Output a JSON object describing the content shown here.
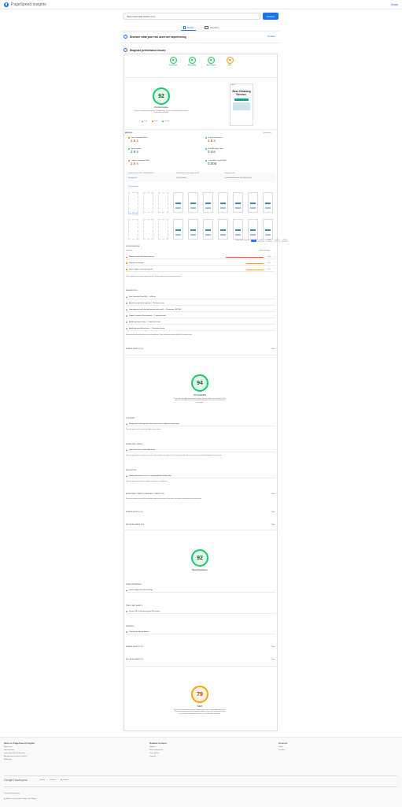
{
  "app": {
    "title": "PageSpeed Insights",
    "share_label": "Share"
  },
  "search": {
    "url": "https://example.teplicn.com",
    "analyze_label": "Analyze"
  },
  "tabs": [
    {
      "label": "Mobile",
      "active": true
    },
    {
      "label": "Desktop",
      "active": false
    }
  ],
  "crux": {
    "title": "Discover what your real users are experiencing",
    "no_data": "No Data"
  },
  "diagnose": {
    "title": "Diagnose performance issues"
  },
  "scores": [
    {
      "label": "Performance",
      "value": "92",
      "color": "#0cce6b"
    },
    {
      "label": "Accessibility",
      "value": "94",
      "color": "#0cce6b"
    },
    {
      "label": "Best Practices",
      "value": "92",
      "color": "#0cce6b"
    },
    {
      "label": "SEO",
      "value": "79",
      "color": "#ffa400"
    }
  ],
  "perf": {
    "score": "92",
    "title": "Performance",
    "note": "Values are estimated and may vary. The performance score is calculated directly from these metrics. See calculator.",
    "legend": [
      "0–49",
      "50–89",
      "90–100"
    ],
    "screenshot": {
      "brand": "Teplica",
      "headline": "Best Cleaning Service."
    }
  },
  "metrics": {
    "header": "METRICS",
    "expand": "Expand view",
    "items": [
      {
        "name": "First Contentful Paint",
        "value": "2.6 s",
        "status": "orange"
      },
      {
        "name": "Time to Interactive",
        "value": "2.6 s",
        "status": "orange"
      },
      {
        "name": "Speed Index",
        "value": "2.9 s",
        "status": "green"
      },
      {
        "name": "Total Blocking Time",
        "value": "0 ms",
        "status": "green"
      },
      {
        "name": "Largest Contentful Paint",
        "value": "2.6 s",
        "status": "orange"
      },
      {
        "name": "Cumulative Layout Shift",
        "value": "0.005",
        "status": "green"
      }
    ]
  },
  "meta": [
    "Captured at Jul 13, 2022, 4:54:58 PM GMT+3",
    "Emulated Moto G4 with Lighthouse 9.6.3",
    "Single page load",
    "Initial page load",
    "Slow 4G throttling",
    "Using HeadlessChromium 102.0.5005.115 with lr"
  ],
  "view_treemap": "View Treemap",
  "filmstrip_label": "Show audits relevant to:",
  "filters": [
    "All",
    "FCP",
    "TBT",
    "LCP",
    "CLS"
  ],
  "opportunities": {
    "header": "OPPORTUNITIES",
    "col_left": "Opportunity",
    "col_right": "Estimated Savings",
    "items": [
      {
        "label": "Eliminate render-blocking resources",
        "saving": "1.46 s",
        "color": "#ff4e42"
      },
      {
        "label": "Properly size images",
        "saving": "0.6 s",
        "color": "#ffa400"
      },
      {
        "label": "Serve images in next-gen formats",
        "saving": "0.6 s",
        "color": "#ffa400"
      }
    ],
    "note": "These suggestions can help your page load faster. They don't directly affect the Performance score."
  },
  "diagnostics": {
    "header": "DIAGNOSTICS",
    "items": [
      "First Contentful Paint (3G) — 5430 ms",
      "Avoid chaining critical requests — 13 chains found",
      "Keep request counts low and transfer sizes small — 45 requests • 867 KiB",
      "Largest Contentful Paint element — 1 element found",
      "Avoid large layout shifts — 5 elements found",
      "Avoid long main-thread tasks — 4 long tasks found"
    ],
    "note": "More information about the performance of your application. These numbers don't directly affect the Performance score."
  },
  "passed_perf": {
    "label": "PASSED AUDITS (33)",
    "show": "Show"
  },
  "accessibility": {
    "score": "94",
    "title": "Accessibility",
    "note": "These checks highlight opportunities to improve the accessibility of your web app. Only a subset of accessibility issues can be automatically detected so manual testing is also encouraged.",
    "groups": [
      {
        "header": "CONTRAST",
        "item": "Background and foreground colors do not have a sufficient contrast ratio.",
        "note": "These are opportunities to improve the legibility of your content."
      },
      {
        "header": "NAMES AND LABELS",
        "item": "Links do not have a discernible name",
        "note": "These are opportunities to improve the semantics of the controls in your application. This may enhance the experience for users of assistive technology, like a screen reader."
      },
      {
        "header": "NAVIGATION",
        "item": "Heading elements are not in a sequentially-descending order",
        "note": "These are opportunities to improve keyboard navigation in your application."
      }
    ],
    "manual": "ADDITIONAL ITEMS TO MANUALLY CHECK (10)",
    "manual_note": "These items address areas which an automated testing tool cannot cover. Learn more in our guide on conducting an accessibility review.",
    "passed": "PASSED AUDITS (19)",
    "na": "NOT APPLICABLE (21)",
    "show": "Show"
  },
  "best_practices": {
    "score": "92",
    "title": "Best Practices",
    "groups": [
      {
        "header": "USER EXPERIENCE",
        "item": "Serves images with low resolution"
      },
      {
        "header": "TRUST AND SAFETY",
        "item": "Ensure CSP is effective against XSS attacks"
      },
      {
        "header": "GENERAL",
        "item": "Detected JavaScript libraries"
      }
    ],
    "passed": "PASSED AUDITS (14)",
    "na": "NOT APPLICABLE (1)",
    "show": "Show"
  },
  "seo": {
    "score": "79",
    "title": "SEO",
    "note": "These checks ensure that your page is following basic search engine optimization advice. There are many additional factors Lighthouse does not score here that may affect your search ranking, including performance on Core Web Vitals. Learn more."
  },
  "footer": {
    "col1": {
      "title": "More on PageSpeed Insights",
      "links": [
        "What's new",
        "Documentation",
        "Learn about Web Performance",
        "Ask questions on Stack Overflow",
        "Mailing list"
      ]
    },
    "col2": {
      "title": "Related Content",
      "links": [
        "Updates",
        "Web Fundamentals",
        "Case Studies",
        "Podcasts"
      ]
    },
    "col3": {
      "title": "Connect",
      "links": [
        "Twitter",
        "YouTube"
      ]
    },
    "brand": "Google Developers",
    "brand_links": [
      "Chrome",
      "Firebase",
      "All products"
    ],
    "legal": "Terms and Privacy Policy",
    "legal_note": "By default, use the Google Developers Site Policies"
  }
}
